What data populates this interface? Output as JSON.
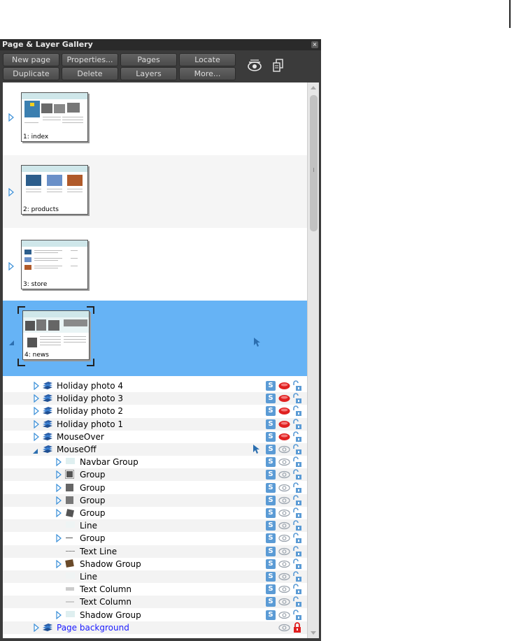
{
  "panel": {
    "title": "Page & Layer Gallery",
    "close_glyph": "×"
  },
  "toolbar": {
    "buttons": [
      {
        "label": "New page"
      },
      {
        "label": "Properties..."
      },
      {
        "label": "Pages"
      },
      {
        "label": "Locate"
      },
      {
        "label": "Duplicate"
      },
      {
        "label": "Delete"
      },
      {
        "label": "Layers"
      },
      {
        "label": "More..."
      }
    ],
    "icons": [
      "show-all-layers-icon",
      "copy-layer-icon"
    ]
  },
  "pages": [
    {
      "label": "1: index",
      "expanded": false,
      "selected": false
    },
    {
      "label": "2: products",
      "expanded": false,
      "selected": false
    },
    {
      "label": "3: store",
      "expanded": false,
      "selected": false
    },
    {
      "label": "4: news",
      "expanded": true,
      "selected": true
    }
  ],
  "layers": [
    {
      "name": "Holiday photo 4",
      "visible": false
    },
    {
      "name": "Holiday photo 3",
      "visible": false
    },
    {
      "name": "Holiday photo 2",
      "visible": false
    },
    {
      "name": "Holiday photo 1",
      "visible": false
    },
    {
      "name": "MouseOver",
      "visible": false
    },
    {
      "name": "MouseOff",
      "visible": true,
      "expanded": true
    },
    {
      "name": "Page background",
      "visible": true,
      "locked": true
    }
  ],
  "objects": [
    {
      "name": "Navbar Group"
    },
    {
      "name": "Group"
    },
    {
      "name": "Group"
    },
    {
      "name": "Group"
    },
    {
      "name": "Group"
    },
    {
      "name": "Line"
    },
    {
      "name": "Group"
    },
    {
      "name": "Text Line"
    },
    {
      "name": "Shadow Group"
    },
    {
      "name": "Line"
    },
    {
      "name": "Text Column"
    },
    {
      "name": "Text Column"
    },
    {
      "name": "Shadow Group"
    }
  ],
  "status": {
    "s_badge": "S"
  },
  "colors": {
    "selection": "#66b3f5",
    "hidden_layer": "#e02020",
    "page_background_text": "#1a1aff",
    "s_badge": "#5b9bd5"
  }
}
